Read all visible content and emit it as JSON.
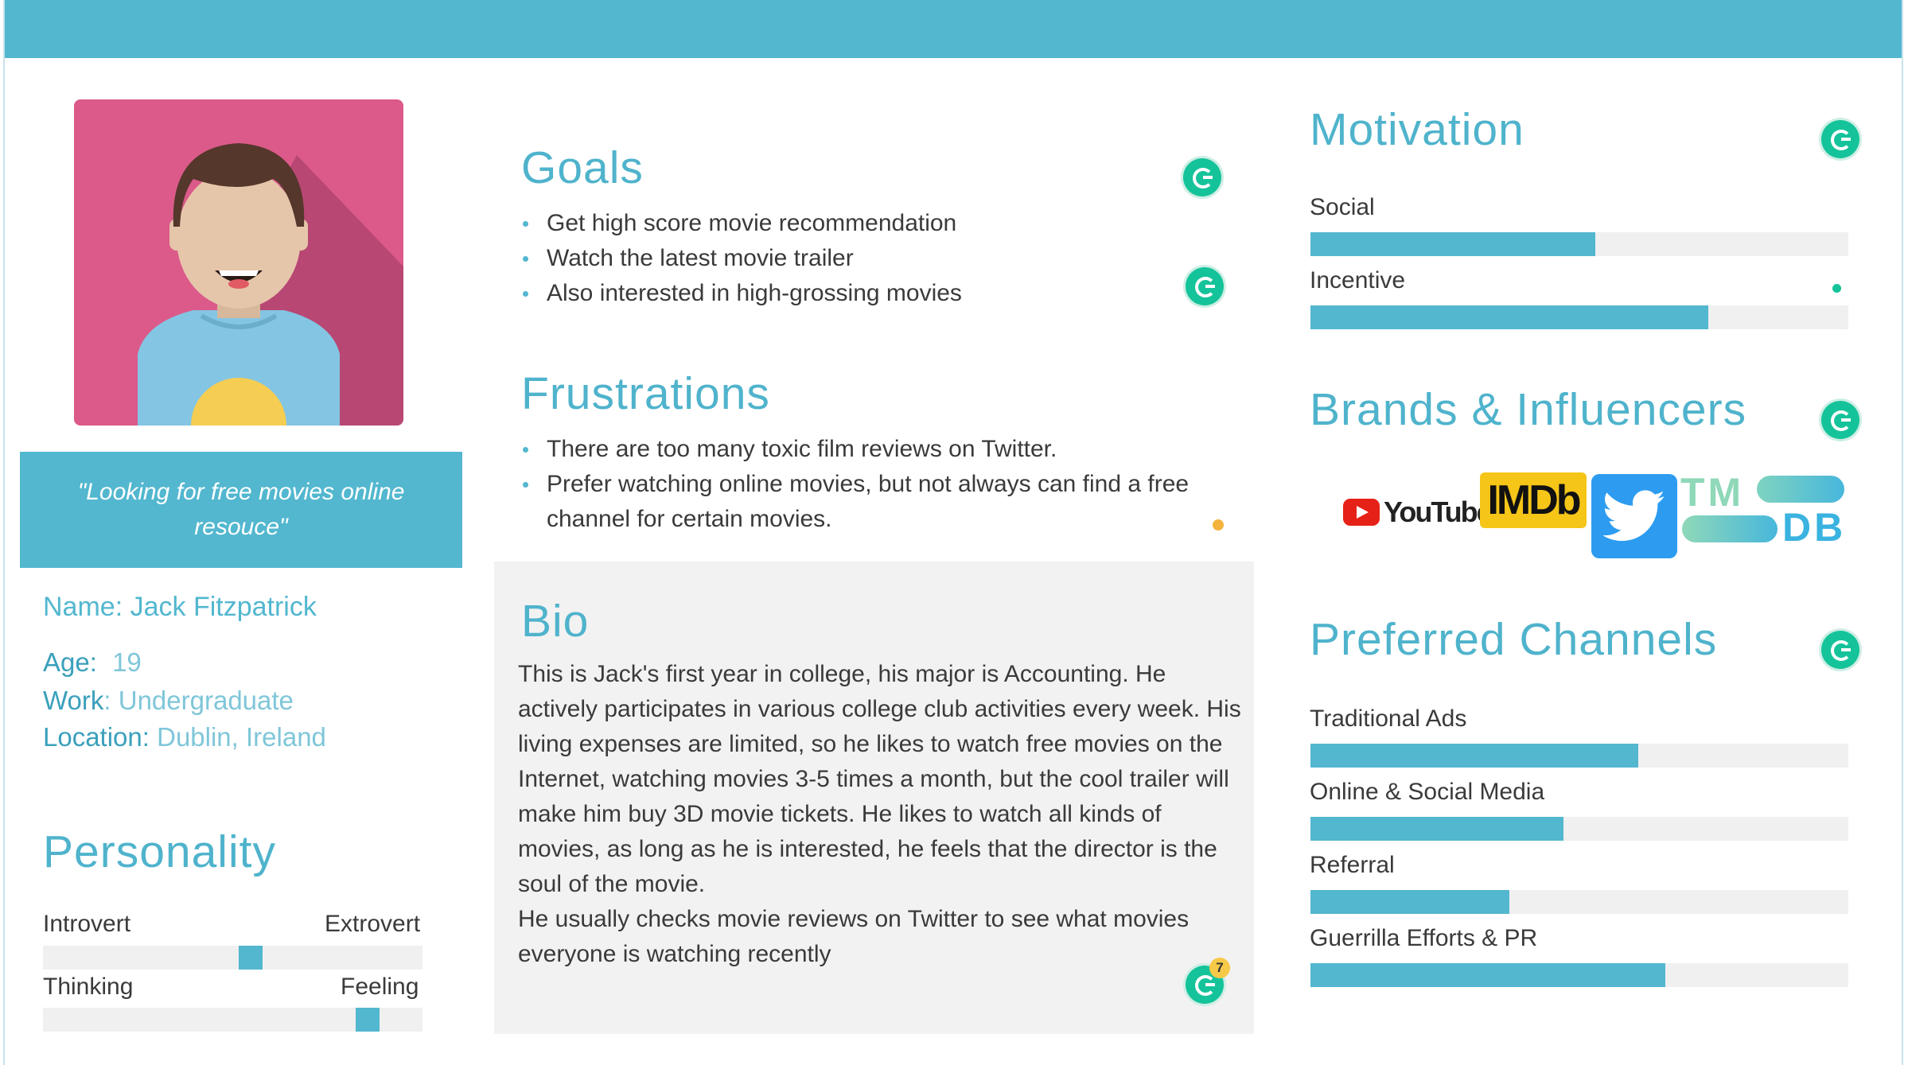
{
  "colors": {
    "accent": "#52b7cf",
    "avatar_bg": "#db5a8a",
    "bio_bg": "#f2f2f2",
    "grammarly": "#15c39a"
  },
  "quote": "\"Looking for free movies online resouce\"",
  "profile": {
    "name_label": "Name:",
    "name_value": "Jack Fitzpatrick",
    "age_label": "Age:",
    "age_value": "19",
    "work_label": "Work",
    "work_value": ": Undergraduate",
    "location_label": "Location:",
    "location_value": "Dublin, Ireland"
  },
  "personality": {
    "title": "Personality",
    "scales": [
      {
        "left": "Introvert",
        "right": "Extrovert",
        "value": 0.55
      },
      {
        "left": "Thinking",
        "right": "Feeling",
        "value": 0.88
      }
    ]
  },
  "goals": {
    "title": "Goals",
    "items": [
      "Get high score movie recommendation",
      "Watch the latest movie trailer",
      "Also interested in high-grossing movies"
    ]
  },
  "frustrations": {
    "title": "Frustrations",
    "items": [
      "There are too many toxic film reviews on Twitter.",
      "Prefer watching online movies, but not always can find a free channel for certain movies."
    ]
  },
  "bio": {
    "title": "Bio",
    "paragraph1": "This is Jack's first year in college, his major is Accounting. He actively participates in various college club activities every week. His living expenses are limited, so he likes to watch free movies on the Internet, watching movies 3-5 times a month, but the cool trailer will make him buy 3D movie tickets. He likes to watch all kinds of movies, as long as he is interested, he feels that the director is the soul of the movie.",
    "paragraph2": "He usually checks movie reviews on Twitter to see what movies everyone is watching recently",
    "grammarly_badge": "7"
  },
  "motivation": {
    "title": "Motivation",
    "items": [
      {
        "label": "Social",
        "value": 0.53
      },
      {
        "label": "Incentive",
        "value": 0.74
      }
    ]
  },
  "brands": {
    "title": "Brands & Influencers",
    "logos": [
      "YouTube",
      "IMDb",
      "twitter-icon",
      "TMDB"
    ],
    "youtube_text": "YouTube",
    "imdb_text": "IMDb",
    "tmdb_top": "TM",
    "tmdb_bottom": "DB"
  },
  "channels": {
    "title": "Preferred Channels",
    "items": [
      {
        "label": "Traditional Ads",
        "value": 0.61
      },
      {
        "label": "Online & Social Media",
        "value": 0.47
      },
      {
        "label": "Referral",
        "value": 0.37
      },
      {
        "label": "Guerrilla Efforts & PR",
        "value": 0.66
      }
    ]
  }
}
